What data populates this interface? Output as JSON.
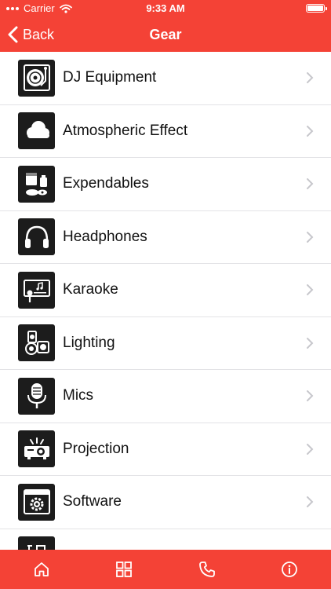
{
  "status_bar": {
    "carrier": "Carrier",
    "time": "9:33 AM"
  },
  "nav": {
    "back_label": "Back",
    "title": "Gear"
  },
  "gear_items": [
    {
      "label": "DJ Equipment",
      "icon": "turntable-icon"
    },
    {
      "label": "Atmospheric Effect",
      "icon": "cloud-icon"
    },
    {
      "label": "Expendables",
      "icon": "paint-supplies-icon"
    },
    {
      "label": "Headphones",
      "icon": "headphones-icon"
    },
    {
      "label": "Karaoke",
      "icon": "karaoke-screen-icon"
    },
    {
      "label": "Lighting",
      "icon": "stage-lights-icon"
    },
    {
      "label": "Mics",
      "icon": "microphone-icon"
    },
    {
      "label": "Projection",
      "icon": "projector-icon"
    },
    {
      "label": "Software",
      "icon": "software-gear-icon"
    },
    {
      "label": "",
      "icon": "partial-item-icon"
    }
  ],
  "tabs": [
    {
      "name": "home",
      "icon": "home-icon"
    },
    {
      "name": "grid",
      "icon": "grid-icon"
    },
    {
      "name": "phone",
      "icon": "phone-icon"
    },
    {
      "name": "info",
      "icon": "info-icon"
    }
  ],
  "colors": {
    "accent": "#f44236",
    "icon_tile": "#1c1c1c",
    "separator": "#e3e3e6",
    "chevron": "#c7c7cc"
  }
}
